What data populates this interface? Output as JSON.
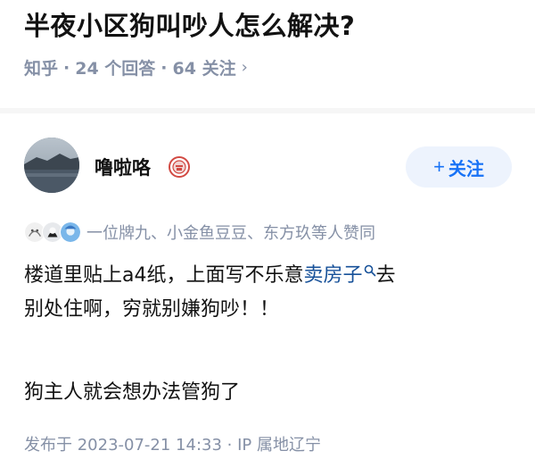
{
  "question": {
    "title": "半夜小区狗叫吵人怎么解决?",
    "source": "知乎",
    "answers": "24 个回答",
    "follows": "64 关注",
    "separator": "·",
    "chevron": "›"
  },
  "answer": {
    "author_name": "噜啦咯",
    "follow_button_plus": "+",
    "follow_button_label": "关注",
    "agree_text": "一位牌九、小金鱼豆豆、东方玖等人赞同",
    "line1_before": "楼道里贴上a4纸，上面写不乐意",
    "line1_link": "卖房子",
    "line1_after": "去",
    "line2": "别处住啊，穷就别嫌狗吵！！",
    "para2": "狗主人就会想办法管狗了",
    "publish_meta": "发布于 2023-07-21 14:33 · IP 属地辽宁"
  },
  "colors": {
    "accent": "#1772f6",
    "muted": "#8590a6",
    "link": "#175199",
    "follow_bg": "#edf3fd"
  },
  "icons": {
    "badge": "award-badge-icon",
    "search": "search-icon",
    "chevron": "chevron-right-icon"
  }
}
